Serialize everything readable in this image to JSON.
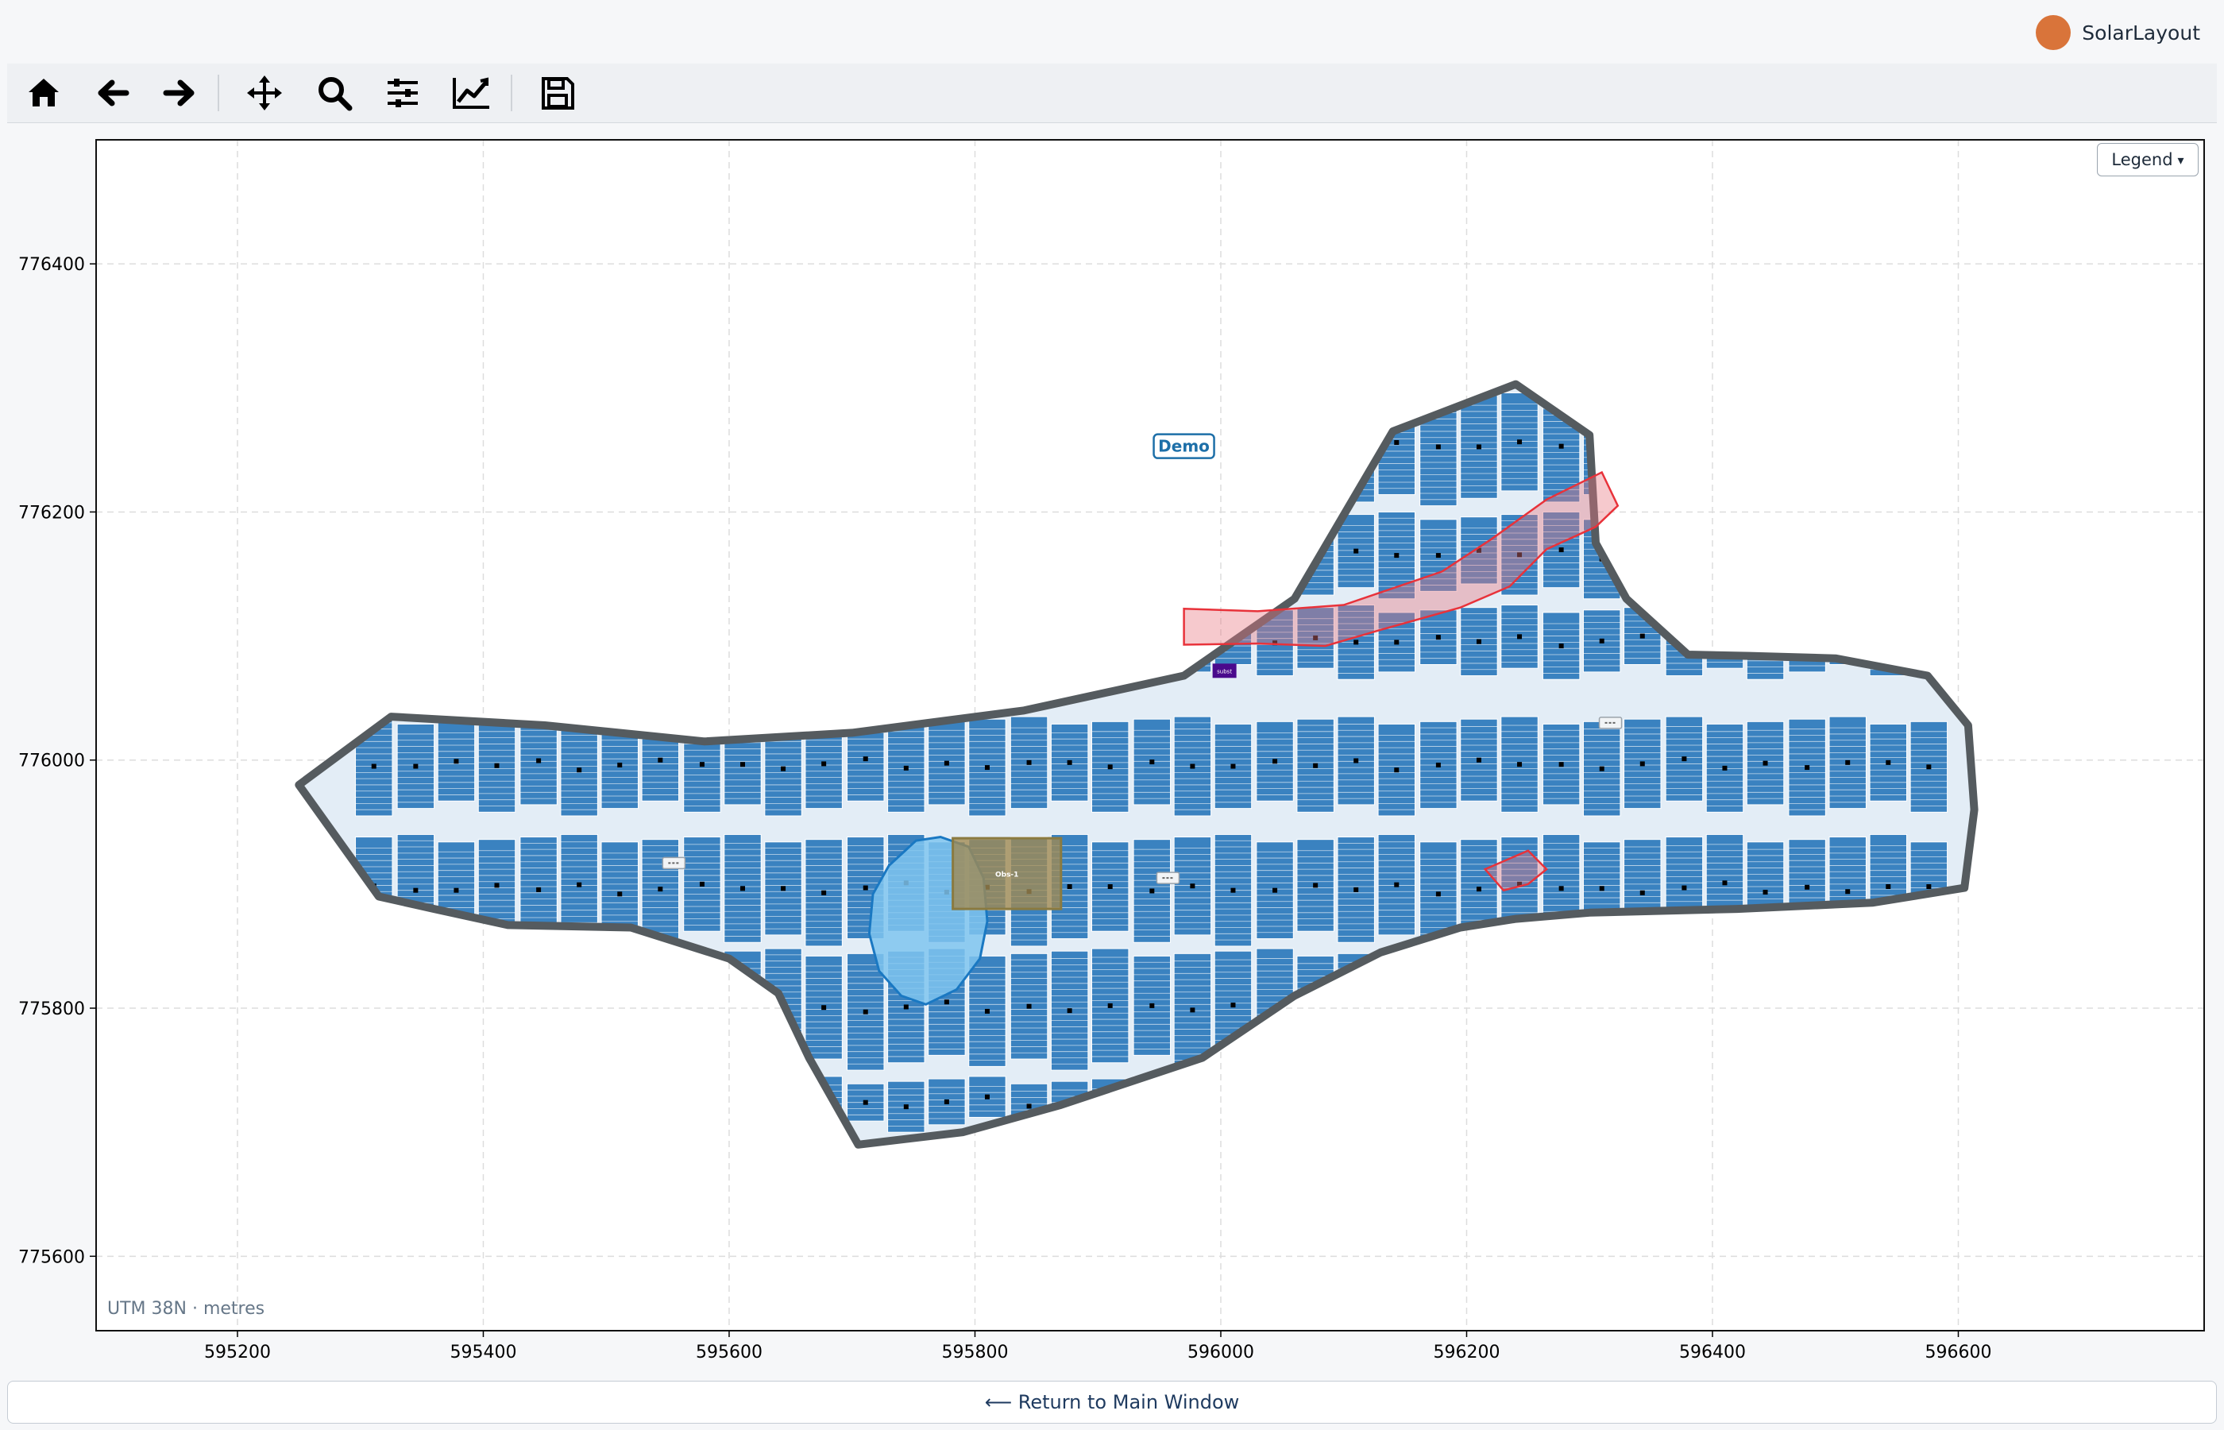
{
  "app": {
    "name": "SolarLayout",
    "accent": "#d9743a"
  },
  "toolbar": {
    "tools": [
      {
        "name": "home-icon",
        "label": "Home"
      },
      {
        "name": "back-icon",
        "label": "Back"
      },
      {
        "name": "forward-icon",
        "label": "Forward"
      },
      {
        "name": "pan-icon",
        "label": "Pan"
      },
      {
        "name": "zoom-icon",
        "label": "Zoom"
      },
      {
        "name": "configure-subplots-icon",
        "label": "Configure subplots"
      },
      {
        "name": "edit-axis-icon",
        "label": "Edit axis"
      },
      {
        "name": "save-icon",
        "label": "Save"
      }
    ]
  },
  "legend_button": {
    "label": "Legend",
    "caret": "▾"
  },
  "crs_label": "UTM 38N · metres",
  "return_button": {
    "label": "⟵  Return to Main Window"
  },
  "map": {
    "project_label": "Demo",
    "obstruction_label": "Obs-1",
    "substation_label": "subst",
    "colors": {
      "boundary": "#555b5f",
      "site_fill": "#e3edf6",
      "panel": "#3a82c0",
      "exclusion": "#e8323a",
      "pond": "#7fc4ef",
      "obstruction": "#a08a52",
      "substation": "#4a0a8c"
    }
  },
  "chart_data": {
    "type": "map",
    "x_ticks": [
      "595200",
      "595400",
      "595600",
      "595800",
      "596000",
      "596200",
      "596400",
      "596600"
    ],
    "y_ticks": [
      "776400",
      "776200",
      "776000",
      "775800",
      "775600"
    ],
    "xlim": [
      595085,
      596800
    ],
    "ylim": [
      775540,
      776500
    ],
    "grid": true,
    "legend_placement": "top-right",
    "boundary": [
      [
        595250,
        775980
      ],
      [
        595325,
        776035
      ],
      [
        595450,
        776028
      ],
      [
        595580,
        776015
      ],
      [
        595700,
        776022
      ],
      [
        595840,
        776040
      ],
      [
        595970,
        776068
      ],
      [
        596060,
        776130
      ],
      [
        596140,
        776265
      ],
      [
        596240,
        776303
      ],
      [
        596300,
        776262
      ],
      [
        596305,
        776175
      ],
      [
        596330,
        776130
      ],
      [
        596380,
        776085
      ],
      [
        596430,
        776084
      ],
      [
        596500,
        776082
      ],
      [
        596575,
        776068
      ],
      [
        596608,
        776028
      ],
      [
        596613,
        775960
      ],
      [
        596605,
        775897
      ],
      [
        596530,
        775885
      ],
      [
        596420,
        775880
      ],
      [
        596300,
        775877
      ],
      [
        596240,
        775872
      ],
      [
        596195,
        775865
      ],
      [
        596130,
        775845
      ],
      [
        596060,
        775810
      ],
      [
        595985,
        775760
      ],
      [
        595870,
        775722
      ],
      [
        595790,
        775700
      ],
      [
        595705,
        775690
      ],
      [
        595665,
        775760
      ],
      [
        595640,
        775812
      ],
      [
        595600,
        775840
      ],
      [
        595520,
        775865
      ],
      [
        595420,
        775867
      ],
      [
        595360,
        775880
      ],
      [
        595315,
        775890
      ]
    ],
    "exclusion_band": [
      [
        595970,
        776122
      ],
      [
        596030,
        776120
      ],
      [
        596100,
        776125
      ],
      [
        596180,
        776152
      ],
      [
        596220,
        776178
      ],
      [
        596265,
        776210
      ],
      [
        596310,
        776232
      ],
      [
        596323,
        776205
      ],
      [
        596305,
        776188
      ],
      [
        596265,
        776170
      ],
      [
        596235,
        776140
      ],
      [
        596195,
        776123
      ],
      [
        596130,
        776105
      ],
      [
        596085,
        776092
      ],
      [
        596030,
        776094
      ],
      [
        595970,
        776093
      ]
    ],
    "exclusion_small": [
      [
        596215,
        775912
      ],
      [
        596250,
        775927
      ],
      [
        596265,
        775912
      ],
      [
        596250,
        775900
      ],
      [
        596230,
        775895
      ]
    ],
    "pond": [
      [
        595795,
        775930
      ],
      [
        595807,
        775905
      ],
      [
        595810,
        775870
      ],
      [
        595804,
        775840
      ],
      [
        595785,
        775815
      ],
      [
        595760,
        775803
      ],
      [
        595740,
        775810
      ],
      [
        595722,
        775830
      ],
      [
        595714,
        775860
      ],
      [
        595717,
        775892
      ],
      [
        595730,
        775915
      ],
      [
        595752,
        775935
      ],
      [
        595772,
        775938
      ]
    ],
    "obstruction": {
      "x": [
        595782,
        595870
      ],
      "y": [
        775880,
        775937
      ]
    },
    "substation": {
      "x": 596003,
      "y": 776072
    },
    "panel_blocks_left_edge": [
      595296,
      595330,
      595363,
      595396,
      595430,
      595463,
      595496,
      595529,
      595563,
      595596,
      595629,
      595662,
      595696,
      595729,
      595762,
      595795,
      595829,
      595862,
      595895,
      595929,
      595962,
      595995,
      596029,
      596062,
      596095,
      596128,
      596162,
      596195,
      596228,
      596262,
      596295,
      596328,
      596362,
      596395,
      596428,
      596462,
      596495,
      596528,
      596561
    ]
  }
}
